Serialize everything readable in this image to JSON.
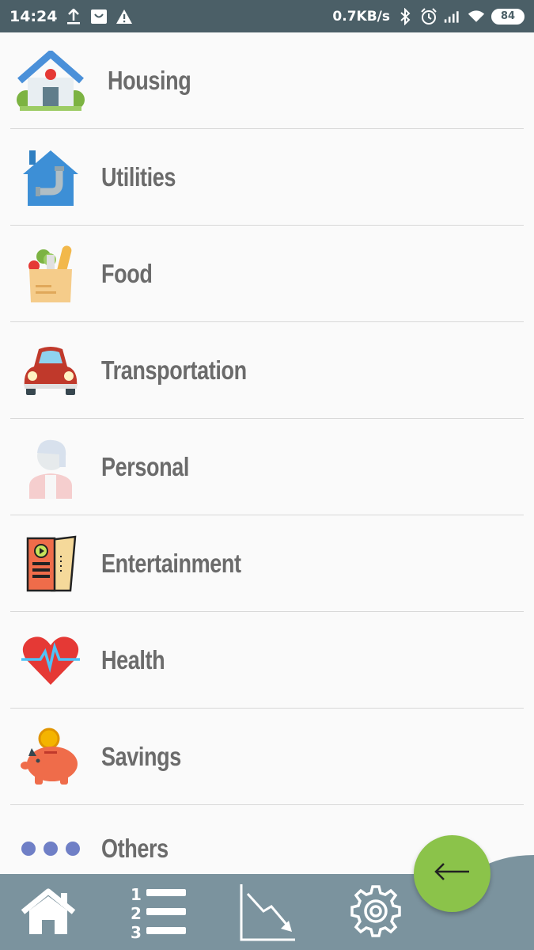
{
  "status_bar": {
    "time": "14:24",
    "network_speed": "0.7KB/s",
    "battery": "84"
  },
  "categories": [
    {
      "label": "Housing",
      "icon": "house-icon"
    },
    {
      "label": "Utilities",
      "icon": "utilities-pipe-icon"
    },
    {
      "label": "Food",
      "icon": "grocery-bag-icon"
    },
    {
      "label": "Transportation",
      "icon": "car-icon"
    },
    {
      "label": "Personal",
      "icon": "person-icon"
    },
    {
      "label": "Entertainment",
      "icon": "ticket-icon"
    },
    {
      "label": "Health",
      "icon": "heart-pulse-icon"
    },
    {
      "label": "Savings",
      "icon": "piggy-bank-icon"
    },
    {
      "label": "Others",
      "icon": "dots-icon"
    }
  ],
  "bottom_nav": [
    {
      "name": "home",
      "icon": "home-icon"
    },
    {
      "name": "list",
      "icon": "numbered-list-icon"
    },
    {
      "name": "chart",
      "icon": "trend-down-chart-icon"
    },
    {
      "name": "settings",
      "icon": "gear-icon"
    }
  ],
  "fab": {
    "icon": "arrow-left-icon"
  },
  "colors": {
    "status_bar": "#4b5f67",
    "bottom_nav": "#7b939e",
    "fab": "#8bc34a",
    "label_text": "#6b6b6b"
  }
}
